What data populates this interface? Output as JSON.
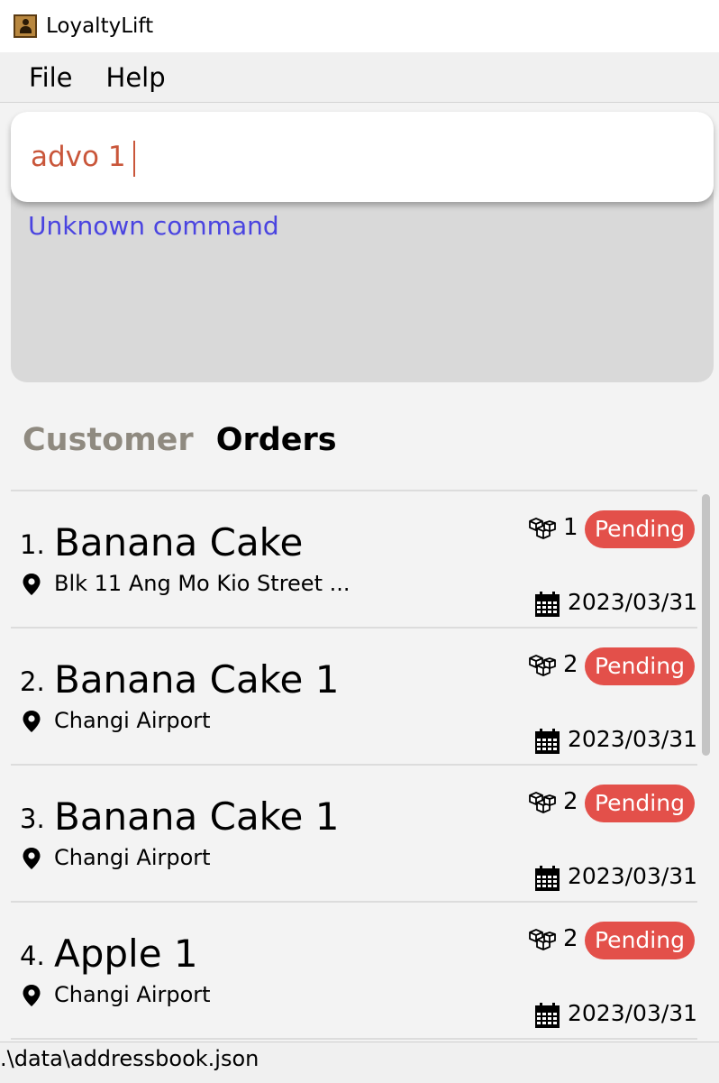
{
  "window": {
    "title": "LoyaltyLift",
    "icon": "address-book-icon"
  },
  "menu": {
    "items": [
      "File",
      "Help"
    ]
  },
  "command": {
    "value": "advo 1",
    "result": "Unknown command"
  },
  "tabs": [
    {
      "label": "Customer",
      "active": false
    },
    {
      "label": "Orders",
      "active": true
    }
  ],
  "orders": [
    {
      "index": "1.",
      "name": "Banana Cake",
      "address": "Blk 11 Ang Mo Kio Street ...",
      "quantity": "1",
      "status": "Pending",
      "date": "2023/03/31"
    },
    {
      "index": "2.",
      "name": "Banana Cake 1",
      "address": "Changi Airport",
      "quantity": "2",
      "status": "Pending",
      "date": "2023/03/31"
    },
    {
      "index": "3.",
      "name": "Banana Cake 1",
      "address": "Changi Airport",
      "quantity": "2",
      "status": "Pending",
      "date": "2023/03/31"
    },
    {
      "index": "4.",
      "name": "Apple 1",
      "address": "Changi Airport",
      "quantity": "2",
      "status": "Pending",
      "date": "2023/03/31"
    }
  ],
  "status_bar": {
    "path": ".\\data\\addressbook.json"
  },
  "colors": {
    "command_text": "#c9563a",
    "result_text": "#4a44e0",
    "badge": "#e3504a",
    "inactive_tab": "#8f8a80"
  }
}
